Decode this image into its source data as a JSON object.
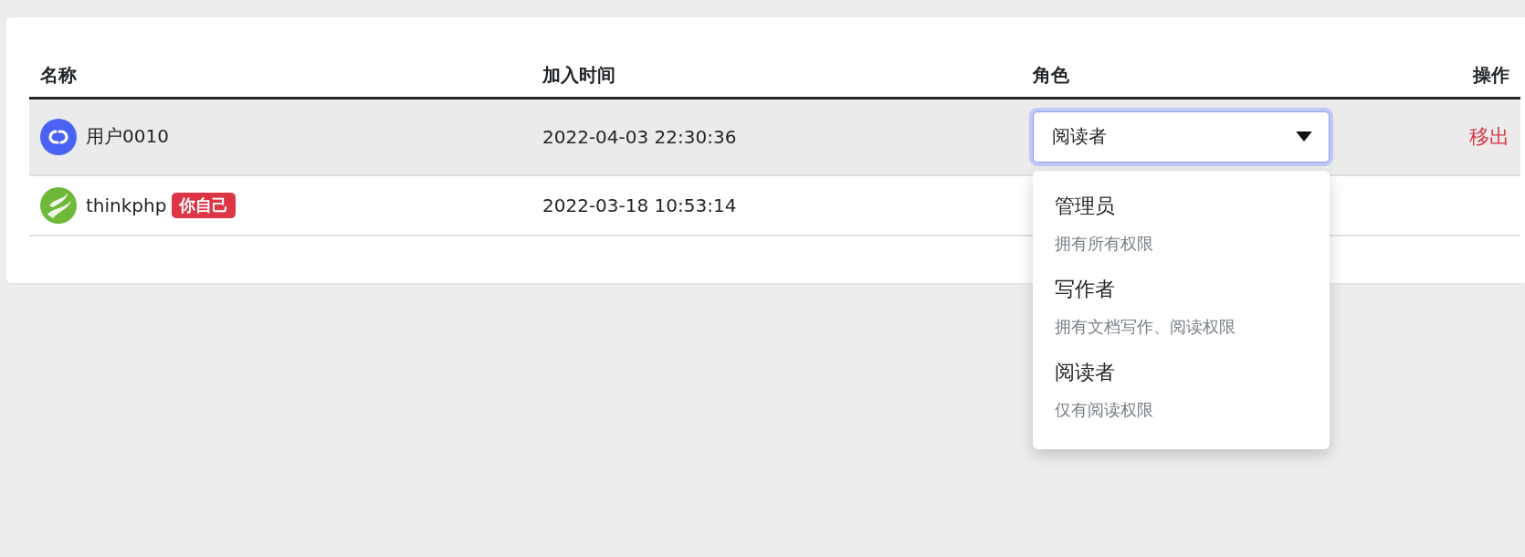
{
  "table": {
    "columns": [
      "名称",
      "加入时间",
      "角色",
      "操作"
    ],
    "rows": [
      {
        "name": "用户0010",
        "joined": "2022-04-03 22:30:36",
        "hovered": true,
        "role": {
          "value": "阅读者",
          "open": true,
          "options": [
            {
              "label": "管理员",
              "description": "拥有所有权限"
            },
            {
              "label": "写作者",
              "description": "拥有文档写作、阅读权限"
            },
            {
              "label": "阅读者",
              "description": "仅有阅读权限"
            }
          ]
        },
        "action": "移出"
      },
      {
        "name": "thinkphp",
        "badge": "你自己",
        "joined": "2022-03-18 10:53:14",
        "hovered": false
      }
    ]
  }
}
